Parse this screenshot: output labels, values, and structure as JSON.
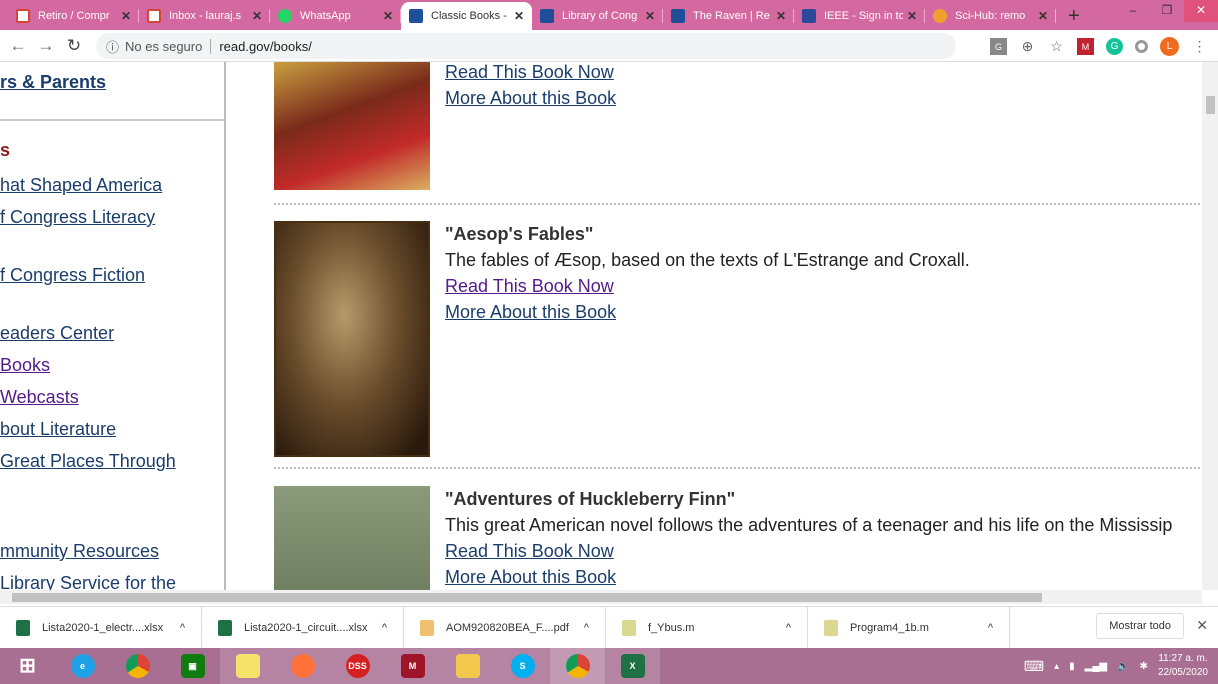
{
  "tabs": [
    {
      "title": "Retiro / Compr",
      "icon": "gmail-icon",
      "color": "#d44638"
    },
    {
      "title": "Inbox - lauraj.s",
      "icon": "gmail-icon",
      "color": "#d44638"
    },
    {
      "title": "WhatsApp",
      "icon": "whatsapp-icon",
      "color": "#25d366"
    },
    {
      "title": "Classic Books -",
      "icon": "loc-icon",
      "color": "#1f4e9a",
      "active": true
    },
    {
      "title": "Library of Cong",
      "icon": "loc-icon",
      "color": "#1f4e9a"
    },
    {
      "title": "The Raven | Re",
      "icon": "loc-icon",
      "color": "#1f4e9a"
    },
    {
      "title": "IEEE - Sign in to",
      "icon": "ieee-icon",
      "color": "#2c4a9b"
    },
    {
      "title": "Sci-Hub: remo",
      "icon": "scihub-icon",
      "color": "#f0a030"
    }
  ],
  "tab_close": "✕",
  "new_tab": "+",
  "window": {
    "minimize": "–",
    "restore": "❐",
    "close": "✕"
  },
  "address": {
    "security": "No es seguro",
    "url": "read.gov/books/",
    "avatar": "L"
  },
  "sidebar": {
    "heading1": "rs & Parents",
    "heading2": "s",
    "links": [
      "hat Shaped America",
      "f Congress Literacy",
      "f Congress Fiction",
      "eaders Center",
      "Books",
      "Webcasts",
      "bout Literature",
      "Great Places Through",
      "mmunity Resources",
      "Library Service for the"
    ]
  },
  "books": [
    {
      "links": [
        "Read This Book Now",
        "More About this Book"
      ]
    },
    {
      "title": "\"Aesop's Fables\"",
      "desc": "The fables of Æsop, based on the texts of L'Estrange and Croxall.",
      "links": [
        "Read This Book Now",
        "More About this Book"
      ]
    },
    {
      "title": "\"Adventures of Huckleberry Finn\"",
      "desc": "This great American novel follows the adventures of a teenager and his life on the Mississip",
      "links": [
        "Read This Book Now",
        "More About this Book"
      ]
    }
  ],
  "downloads": {
    "items": [
      "Lista2020-1_electr....xlsx",
      "Lista2020-1_circuit....xlsx",
      "AOM920820BEA_F....pdf",
      "f_Ybus.m",
      "Program4_1b.m"
    ],
    "show_all": "Mostrar todo",
    "close": "✕"
  },
  "taskbar": {
    "apps": [
      "start",
      "ie",
      "chrome",
      "store",
      "sticky-notes",
      "firefox",
      "dss",
      "mendeley",
      "file-explorer",
      "skype",
      "chrome",
      "excel"
    ],
    "time": "11:27 a. m.",
    "date": "22/05/2020"
  }
}
